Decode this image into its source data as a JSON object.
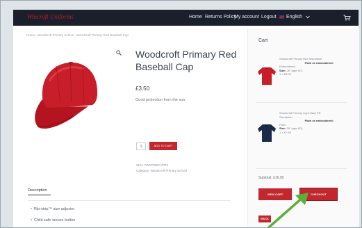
{
  "colors": {
    "accent": "#c1272d",
    "topbar": "#1a1f2b",
    "arrow": "#5cae3a"
  },
  "header": {
    "logo": "Wincroft Uniforms",
    "nav": [
      "Home",
      "Returns Policy",
      "My account",
      "Logout",
      "English"
    ],
    "language_icon": "uk-flag-icon",
    "cart_icon": "cart-icon"
  },
  "breadcrumb": "Home  ›  Woodcroft Primary School  ›  Woodcroft Primary Red Baseball Cap",
  "product": {
    "title": "Woodcroft Primary Red Baseball Cap",
    "price": "£3.50",
    "short_description": "Good protection from the sun.",
    "quantity": "1",
    "add_to_cart": "ADD TO CART",
    "sku": "SKU: TWCPBBCAPRS",
    "category": "Category: Woodcroft Primary School",
    "image_icon": "red-baseball-cap",
    "magnify_icon": "search-icon"
  },
  "tabs": {
    "description": "Description"
  },
  "features": [
    "Rip-strip™ size adjuster",
    "Child safe secure button"
  ],
  "cart": {
    "title": "Cart",
    "items": [
      {
        "name": "Woodcroft Primary Red Sweatshirt",
        "option_label": "Plain or embroidered:",
        "option_value": "Embroidered",
        "size_label": "Size:",
        "size_value": "28\" (age 6/7)",
        "qty_price": "1 × £8.95",
        "thumb_icon": "red-sweatshirt"
      },
      {
        "name": "Woodcroft Primary Light Navy PE Sweatshirt",
        "option_label": "Plain or embroidered:",
        "option_value": "Plain",
        "size_label": "Size:",
        "size_value": "28\" (age 6/7)",
        "qty_price": "1 × £7.95",
        "thumb_icon": "navy-sweatshirt"
      }
    ],
    "subtotal": "Subtotal: £16.90",
    "view_cart": "VIEW CART",
    "checkout": "CHECKOUT",
    "back": "BACK"
  }
}
